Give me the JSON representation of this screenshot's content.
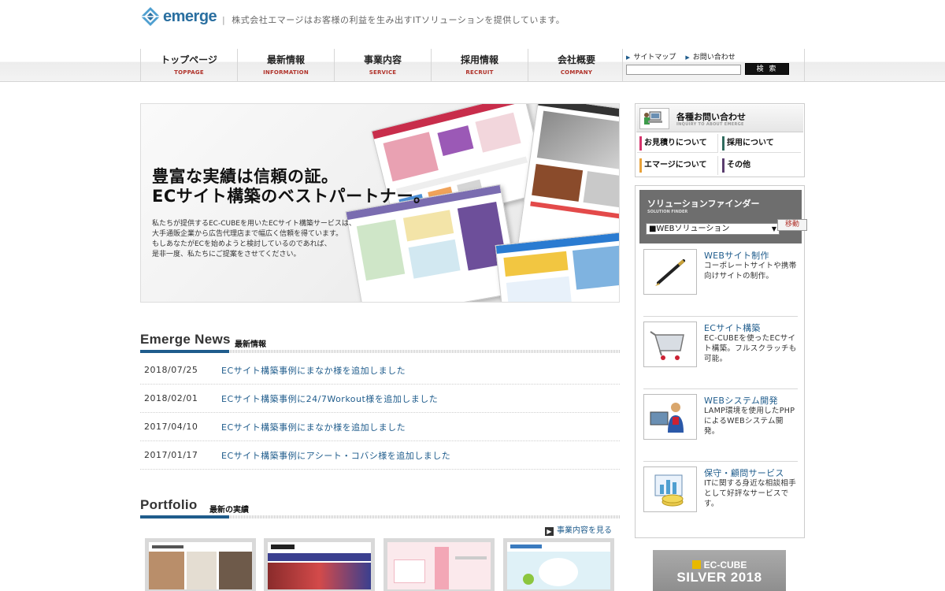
{
  "header": {
    "logo_text": "emerge",
    "tagline_sep": "|",
    "tagline": "株式会社エマージはお客様の利益を生み出すITソリューションを提供しています。"
  },
  "nav": [
    {
      "ja": "トップページ",
      "en": "TOPPAGE"
    },
    {
      "ja": "最新情報",
      "en": "INFORMATION"
    },
    {
      "ja": "事業内容",
      "en": "SERVICE"
    },
    {
      "ja": "採用情報",
      "en": "RECRUIT"
    },
    {
      "ja": "会社概要",
      "en": "COMPANY"
    }
  ],
  "util": {
    "sitemap": "サイトマップ",
    "contact": "お問い合わせ",
    "search_value": "",
    "search_button": "検 索"
  },
  "hero": {
    "title_line1": "豊富な実績は信頼の証。",
    "title_line2": "ECサイト構築のベストパートナー。",
    "body": "私たちが提供するEC-CUBEを用いたECサイト構築サービスは、\n大手通販企業から広告代理店まで幅広く信頼を得ています。\nもしあなたがECを始めようと検討しているのであれば、\n是非一度、私たちにご提案をさせてください。"
  },
  "news": {
    "heading_en": "Emerge News",
    "heading_ja": "最新情報",
    "items": [
      {
        "date": "2018/07/25",
        "text": "ECサイト構築事例にまなか様を追加しました"
      },
      {
        "date": "2018/02/01",
        "text": "ECサイト構築事例に24/7Workout様を追加しました"
      },
      {
        "date": "2017/04/10",
        "text": "ECサイト構築事例にまなか様を追加しました"
      },
      {
        "date": "2017/01/17",
        "text": "ECサイト構築事例にアシート・コバシ様を追加しました"
      }
    ]
  },
  "portfolio": {
    "heading_en": "Portfolio",
    "heading_ja": "最新の実績",
    "more_link": "事業内容を見る"
  },
  "contact_box": {
    "title": "各種お問い合わせ",
    "subtitle": "INQUIRY TO ABOUT EMERGE",
    "cells": [
      {
        "label": "お見積りについて",
        "color": "#d6336c"
      },
      {
        "label": "採用について",
        "color": "#2f6b5e"
      },
      {
        "label": "エマージについて",
        "color": "#e8a23a"
      },
      {
        "label": "その他",
        "color": "#5a3d6e"
      }
    ]
  },
  "finder": {
    "title": "ソリューションファインダー",
    "subtitle": "SOLUTION FINDER",
    "selected": "■WEBソリューション",
    "go": "移動",
    "services": [
      {
        "title": "WEBサイト制作",
        "desc": "コーポレートサイトや携帯向けサイトの制作。",
        "icon": "pen-icon"
      },
      {
        "title": "ECサイト構築",
        "desc": "EC-CUBEを使ったECサイト構築。フルスクラッチも可能。",
        "icon": "cart-icon"
      },
      {
        "title": "WEBシステム開発",
        "desc": "LAMP環境を使用したPHPによるWEBシステム開発。",
        "icon": "developer-icon"
      },
      {
        "title": "保守・顧問サービス",
        "desc": "ITに関する身近な相談相手として好評なサービスです。",
        "icon": "chart-coins-icon"
      }
    ]
  },
  "badge": {
    "line1": "EC-CUBE",
    "line2": "SILVER 2018"
  },
  "colors": {
    "accent": "#1f5c8c",
    "nav_en": "#b0322a"
  }
}
